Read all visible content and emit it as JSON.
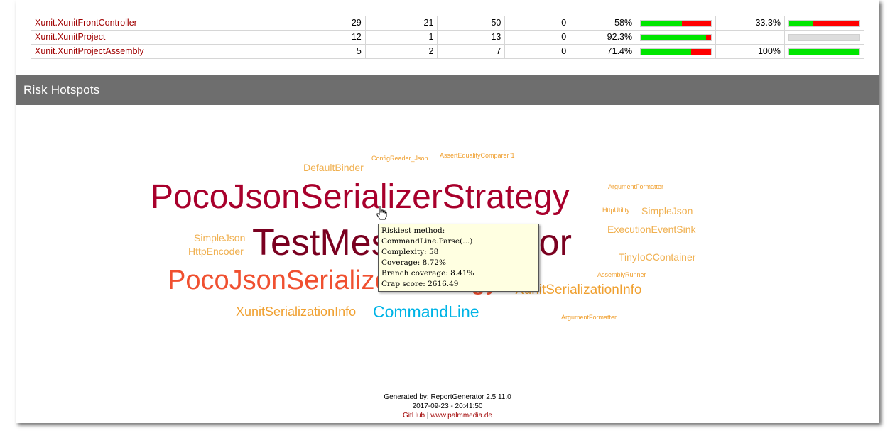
{
  "table": {
    "rows": [
      {
        "name": "Xunit.XunitFrontController",
        "covered": "29",
        "uncovered": "21",
        "coverable": "50",
        "total": "0",
        "line_coverage": "58%",
        "line_fill": 0.58,
        "branch_coverage": "33.3%",
        "branch_fill": 0.333,
        "branch_empty": false
      },
      {
        "name": "Xunit.XunitProject",
        "covered": "12",
        "uncovered": "1",
        "coverable": "13",
        "total": "0",
        "line_coverage": "92.3%",
        "line_fill": 0.923,
        "branch_coverage": "",
        "branch_fill": 0,
        "branch_empty": true
      },
      {
        "name": "Xunit.XunitProjectAssembly",
        "covered": "5",
        "uncovered": "2",
        "coverable": "7",
        "total": "0",
        "line_coverage": "71.4%",
        "line_fill": 0.714,
        "branch_coverage": "100%",
        "branch_fill": 1.0,
        "branch_empty": false
      }
    ]
  },
  "section": {
    "title": "Risk Hotspots"
  },
  "cloud": {
    "words": [
      {
        "text": "ConfigReader_Json",
        "color": "#f0a030"
      },
      {
        "text": "AssertEqualityComparer`1",
        "color": "#f0a030"
      },
      {
        "text": "DefaultBinder",
        "color": "#f0b050"
      },
      {
        "text": "PocoJsonSerializerStrategy",
        "color": "#a8002c"
      },
      {
        "text": "ArgumentFormatter",
        "color": "#f0a030"
      },
      {
        "text": "HttpUtility",
        "color": "#f0a030"
      },
      {
        "text": "SimpleJson",
        "color": "#f0b050"
      },
      {
        "text": "ExecutionEventSink",
        "color": "#f0b050"
      },
      {
        "text": "SimpleJson",
        "color": "#f0b050"
      },
      {
        "text": "TestMessageVisitor",
        "color": "#7a0020"
      },
      {
        "text": "HttpEncoder",
        "color": "#f0b050"
      },
      {
        "text": "TinyIoCContainer",
        "color": "#f0b050"
      },
      {
        "text": "AssemblyRunner",
        "color": "#f0a030"
      },
      {
        "text": "PocoJsonSerializerStrategy",
        "color": "#f05030"
      },
      {
        "text": "XunitSerializationInfo",
        "color": "#f0a030"
      },
      {
        "text": "XunitSerializationInfo",
        "color": "#f0a030"
      },
      {
        "text": "CommandLine",
        "color": "#00b4e6"
      },
      {
        "text": "ArgumentFormatter",
        "color": "#f0a030"
      }
    ]
  },
  "tooltip": {
    "line1": "Riskiest method: CommandLine.Parse(...)",
    "line2": "Complexity: 58",
    "line3": "Coverage: 8.72%",
    "line4": "Branch coverage: 8.41%",
    "line5": "Crap score: 2616.49"
  },
  "footer": {
    "generated": "Generated by: ReportGenerator 2.5.11.0",
    "date": "2017-09-23 - 20:41:50",
    "github": "GitHub",
    "separator": " | ",
    "site": "www.palmmedia.de"
  }
}
